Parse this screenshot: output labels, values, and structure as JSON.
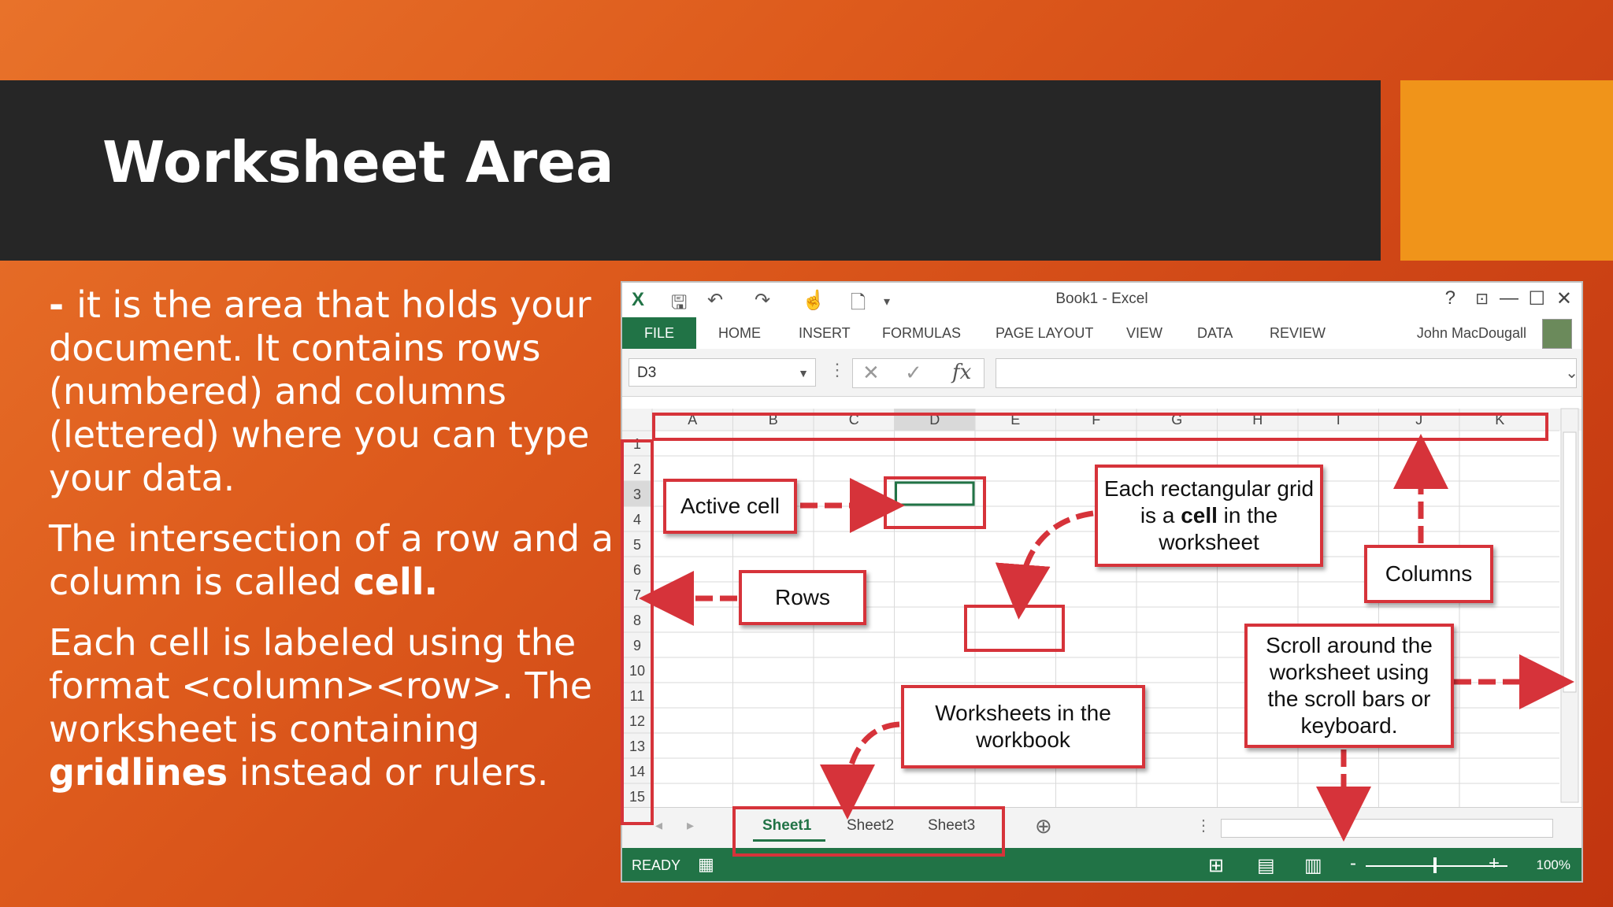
{
  "slide": {
    "title": "Worksheet Area",
    "para1_prefix": "- ",
    "para1": "it is the area that holds your document. It contains rows (numbered) and columns (lettered) where you can type your data.",
    "para2_text": "The intersection of a row and a column is called ",
    "para2_bold": "cell.",
    "para3_text": "Each cell is labeled using the format <column><row>. The worksheet is containing ",
    "para3_bold": "gridlines",
    "para3_tail": " instead or rulers."
  },
  "excel": {
    "window_title": "Book1 - Excel",
    "ribbon_tabs": [
      "FILE",
      "HOME",
      "INSERT",
      "FORMULAS",
      "PAGE LAYOUT",
      "VIEW",
      "DATA",
      "REVIEW"
    ],
    "user_name": "John MacDougall",
    "name_box": "D3",
    "fx_label": "fx",
    "columns": [
      "A",
      "B",
      "C",
      "D",
      "E",
      "F",
      "G",
      "H",
      "I",
      "J",
      "K"
    ],
    "rows": [
      "1",
      "2",
      "3",
      "4",
      "5",
      "6",
      "7",
      "8",
      "9",
      "10",
      "11",
      "12",
      "13",
      "14",
      "15"
    ],
    "sheets": [
      "Sheet1",
      "Sheet2",
      "Sheet3"
    ],
    "status": "READY",
    "zoom": "100%",
    "help": "?",
    "minimize": "—",
    "maximize": "☐",
    "close": "✕"
  },
  "callouts": {
    "active_cell": "Active cell",
    "rows": "Rows",
    "cell_desc_1": "Each rectangular grid is a ",
    "cell_desc_bold": "cell",
    "cell_desc_2": " in the worksheet",
    "columns": "Columns",
    "scroll": "Scroll around the worksheet using the scroll bars or keyboard.",
    "worksheets": "Worksheets in the workbook"
  },
  "colors": {
    "excel_green": "#217346",
    "callout_red": "#d6333a",
    "accent_orange": "#f0941a",
    "title_bg": "#262626"
  }
}
